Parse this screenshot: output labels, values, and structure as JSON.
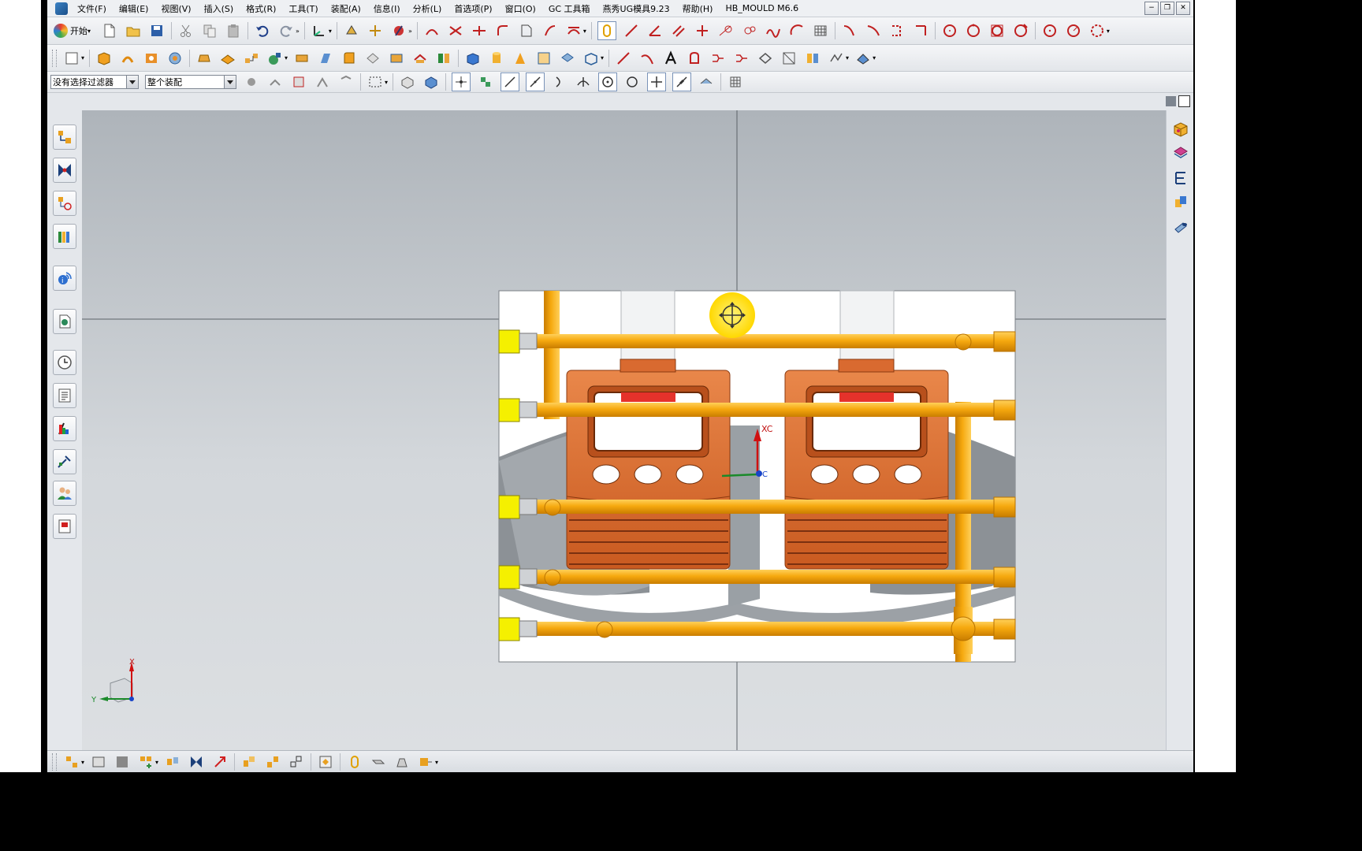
{
  "menubar": {
    "items": [
      "文件(F)",
      "编辑(E)",
      "视图(V)",
      "插入(S)",
      "格式(R)",
      "工具(T)",
      "装配(A)",
      "信息(I)",
      "分析(L)",
      "首选项(P)",
      "窗口(O)",
      "GC 工具箱",
      "燕秀UG模具9.23",
      "帮助(H)",
      "HB_MOULD M6.6"
    ]
  },
  "window_controls": {
    "minimize": "−",
    "restore": "❐",
    "close": "✕"
  },
  "toolbar": {
    "start_label": "开始",
    "selection_filter": "没有选择过滤器",
    "scope": "整个装配"
  },
  "canvas": {
    "wcs_label": "XC",
    "wcs_origin_label": "C",
    "triad_x_label": "X",
    "triad_y_label": "Y"
  },
  "colors": {
    "pipe": "#f4a30b",
    "part_orange": "#e2763a",
    "connector_yellow": "#f5f000",
    "window_red": "#e5322b",
    "cursor_highlight": "#ffe000"
  },
  "icons": {
    "left_resource_bar": [
      "assembly-navigator-icon",
      "constraint-navigator-icon",
      "part-navigator-icon",
      "reuse-library-icon",
      "hd3d-tools-icon",
      "web-browser-icon",
      "history-icon",
      "system-materials-icon",
      "process-studio-icon",
      "manufacturing-wizard-icon",
      "roles-icon",
      "system-scenes-icon"
    ],
    "right_bar": [
      "solid-view-icon",
      "face-view-icon",
      "structure-icon",
      "assembly-view-icon",
      "cylinder-view-icon"
    ]
  }
}
